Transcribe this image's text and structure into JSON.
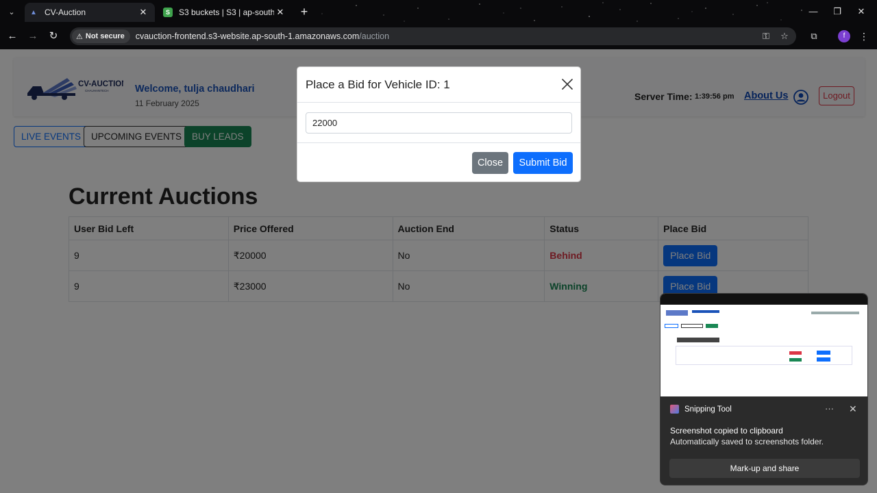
{
  "browser": {
    "tabs": [
      {
        "title": "CV-Auction",
        "active": true,
        "icon": "car-favicon"
      },
      {
        "title": "S3 buckets | S3 | ap-south-1",
        "active": false,
        "icon": "s3-favicon"
      }
    ],
    "security_chip": "Not secure",
    "url_host": "cvauction-frontend.s3-website.ap-south-1.amazonaws.com",
    "url_path": "/auction",
    "profile_initial": "f"
  },
  "header": {
    "brand": "CV-AUCTION",
    "brand_tagline": "CHAUHANTECH",
    "welcome": "Welcome, tulja chaudhari",
    "date": "11 February 2025",
    "server_time_label": "Server Time:",
    "server_time": "1:39:56 pm",
    "about_label": "About Us",
    "logout_label": "Logout"
  },
  "events": {
    "live": "LIVE EVENTS",
    "upcoming": "UPCOMING EVENTS",
    "leads": "BUY LEADS"
  },
  "auctions": {
    "title": "Current Auctions",
    "columns": [
      "User Bid Left",
      "Price Offered",
      "Auction End",
      "Status",
      "Place Bid"
    ],
    "rows": [
      {
        "bids_left": "9",
        "price": "₹20000",
        "auction_end": "No",
        "status": "Behind",
        "action": "Place Bid"
      },
      {
        "bids_left": "9",
        "price": "₹23000",
        "auction_end": "No",
        "status": "Winning",
        "action": "Place Bid"
      }
    ]
  },
  "modal": {
    "title": "Place a Bid for Vehicle ID: 1",
    "bid_value": "22000",
    "close_label": "Close",
    "submit_label": "Submit Bid"
  },
  "toast": {
    "app_name": "Snipping Tool",
    "title": "Screenshot copied to clipboard",
    "body": "Automatically saved to screenshots folder.",
    "action_label": "Mark-up and share"
  },
  "colors": {
    "primary": "#0d6efd",
    "success": "#198754",
    "danger": "#dc3545",
    "secondary": "#6c757d",
    "link": "#0d47b5"
  }
}
